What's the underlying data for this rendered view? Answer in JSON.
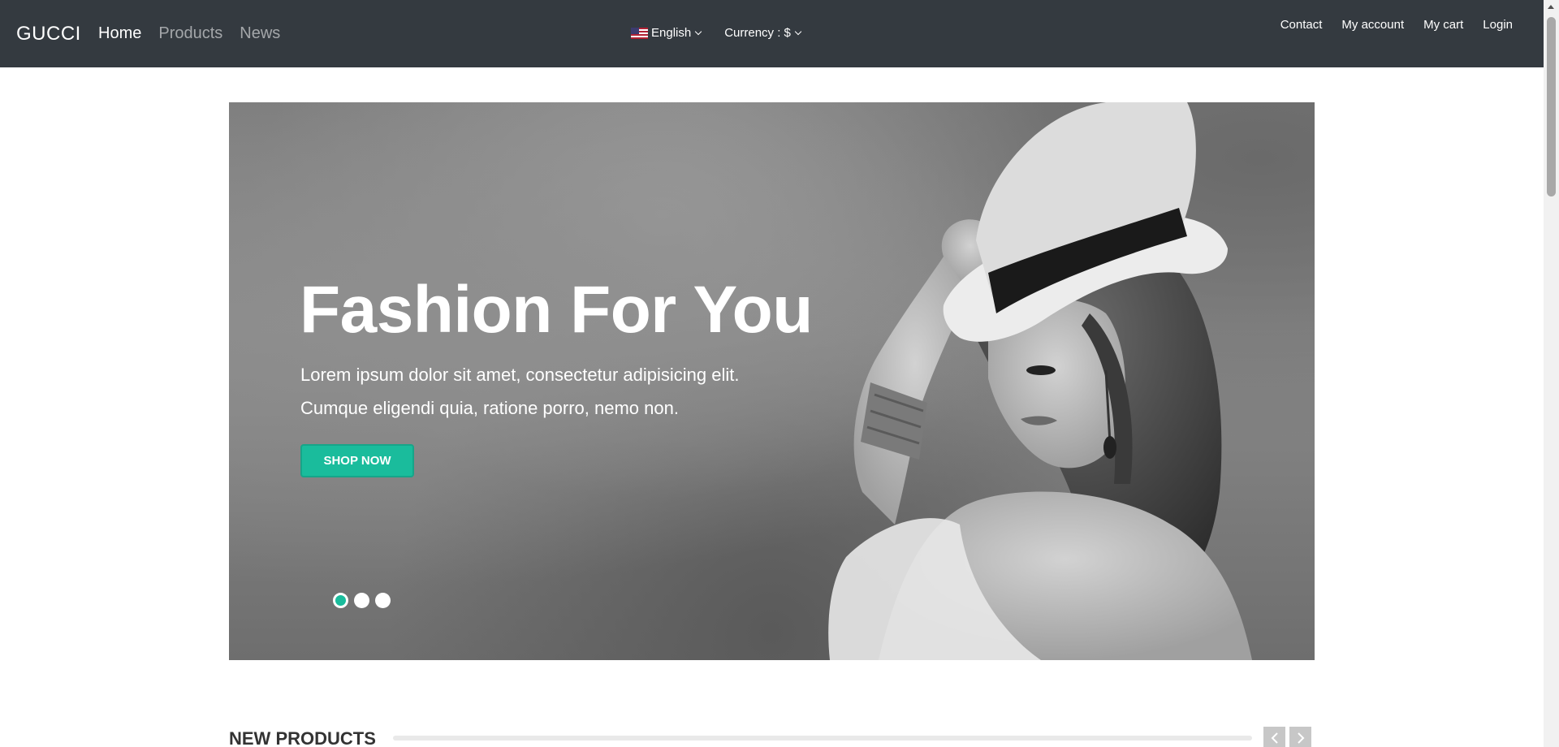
{
  "navbar": {
    "brand": "GUCCI",
    "main_links": [
      {
        "label": "Home"
      },
      {
        "label": "Products"
      },
      {
        "label": "News"
      }
    ],
    "language": {
      "label": "English",
      "flag_icon": "us-flag-icon"
    },
    "currency": {
      "label": "Currency : $"
    },
    "right_links": [
      {
        "label": "Contact"
      },
      {
        "label": "My account"
      },
      {
        "label": "My cart"
      },
      {
        "label": "Login"
      }
    ]
  },
  "hero": {
    "title": "Fashion For You",
    "text": "Lorem ipsum dolor sit amet, consectetur adipisicing elit. Cumque eligendi quia, ratione porro, nemo non.",
    "button_label": "SHOP NOW",
    "slide_count": 3,
    "active_slide": 1,
    "image": "woman-in-hat-photo"
  },
  "new_products": {
    "title": "NEW PRODUCTS",
    "prev_icon": "chevron-left-icon",
    "next_icon": "chevron-right-icon"
  },
  "colors": {
    "navbar_bg": "#343a40",
    "accent": "#1abc9c"
  }
}
